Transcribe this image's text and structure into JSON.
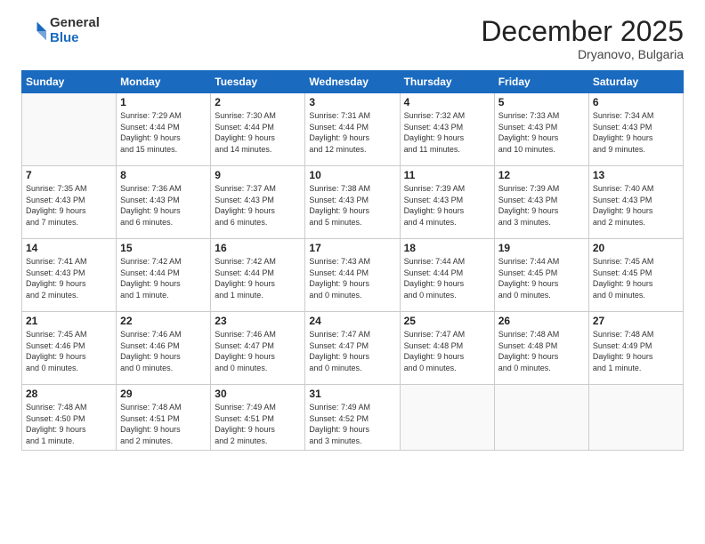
{
  "logo": {
    "general": "General",
    "blue": "Blue"
  },
  "header": {
    "month": "December 2025",
    "location": "Dryanovo, Bulgaria"
  },
  "weekdays": [
    "Sunday",
    "Monday",
    "Tuesday",
    "Wednesday",
    "Thursday",
    "Friday",
    "Saturday"
  ],
  "weeks": [
    [
      {
        "day": "",
        "info": ""
      },
      {
        "day": "1",
        "info": "Sunrise: 7:29 AM\nSunset: 4:44 PM\nDaylight: 9 hours\nand 15 minutes."
      },
      {
        "day": "2",
        "info": "Sunrise: 7:30 AM\nSunset: 4:44 PM\nDaylight: 9 hours\nand 14 minutes."
      },
      {
        "day": "3",
        "info": "Sunrise: 7:31 AM\nSunset: 4:44 PM\nDaylight: 9 hours\nand 12 minutes."
      },
      {
        "day": "4",
        "info": "Sunrise: 7:32 AM\nSunset: 4:43 PM\nDaylight: 9 hours\nand 11 minutes."
      },
      {
        "day": "5",
        "info": "Sunrise: 7:33 AM\nSunset: 4:43 PM\nDaylight: 9 hours\nand 10 minutes."
      },
      {
        "day": "6",
        "info": "Sunrise: 7:34 AM\nSunset: 4:43 PM\nDaylight: 9 hours\nand 9 minutes."
      }
    ],
    [
      {
        "day": "7",
        "info": "Sunrise: 7:35 AM\nSunset: 4:43 PM\nDaylight: 9 hours\nand 7 minutes."
      },
      {
        "day": "8",
        "info": "Sunrise: 7:36 AM\nSunset: 4:43 PM\nDaylight: 9 hours\nand 6 minutes."
      },
      {
        "day": "9",
        "info": "Sunrise: 7:37 AM\nSunset: 4:43 PM\nDaylight: 9 hours\nand 6 minutes."
      },
      {
        "day": "10",
        "info": "Sunrise: 7:38 AM\nSunset: 4:43 PM\nDaylight: 9 hours\nand 5 minutes."
      },
      {
        "day": "11",
        "info": "Sunrise: 7:39 AM\nSunset: 4:43 PM\nDaylight: 9 hours\nand 4 minutes."
      },
      {
        "day": "12",
        "info": "Sunrise: 7:39 AM\nSunset: 4:43 PM\nDaylight: 9 hours\nand 3 minutes."
      },
      {
        "day": "13",
        "info": "Sunrise: 7:40 AM\nSunset: 4:43 PM\nDaylight: 9 hours\nand 2 minutes."
      }
    ],
    [
      {
        "day": "14",
        "info": "Sunrise: 7:41 AM\nSunset: 4:43 PM\nDaylight: 9 hours\nand 2 minutes."
      },
      {
        "day": "15",
        "info": "Sunrise: 7:42 AM\nSunset: 4:44 PM\nDaylight: 9 hours\nand 1 minute."
      },
      {
        "day": "16",
        "info": "Sunrise: 7:42 AM\nSunset: 4:44 PM\nDaylight: 9 hours\nand 1 minute."
      },
      {
        "day": "17",
        "info": "Sunrise: 7:43 AM\nSunset: 4:44 PM\nDaylight: 9 hours\nand 0 minutes."
      },
      {
        "day": "18",
        "info": "Sunrise: 7:44 AM\nSunset: 4:44 PM\nDaylight: 9 hours\nand 0 minutes."
      },
      {
        "day": "19",
        "info": "Sunrise: 7:44 AM\nSunset: 4:45 PM\nDaylight: 9 hours\nand 0 minutes."
      },
      {
        "day": "20",
        "info": "Sunrise: 7:45 AM\nSunset: 4:45 PM\nDaylight: 9 hours\nand 0 minutes."
      }
    ],
    [
      {
        "day": "21",
        "info": "Sunrise: 7:45 AM\nSunset: 4:46 PM\nDaylight: 9 hours\nand 0 minutes."
      },
      {
        "day": "22",
        "info": "Sunrise: 7:46 AM\nSunset: 4:46 PM\nDaylight: 9 hours\nand 0 minutes."
      },
      {
        "day": "23",
        "info": "Sunrise: 7:46 AM\nSunset: 4:47 PM\nDaylight: 9 hours\nand 0 minutes."
      },
      {
        "day": "24",
        "info": "Sunrise: 7:47 AM\nSunset: 4:47 PM\nDaylight: 9 hours\nand 0 minutes."
      },
      {
        "day": "25",
        "info": "Sunrise: 7:47 AM\nSunset: 4:48 PM\nDaylight: 9 hours\nand 0 minutes."
      },
      {
        "day": "26",
        "info": "Sunrise: 7:48 AM\nSunset: 4:48 PM\nDaylight: 9 hours\nand 0 minutes."
      },
      {
        "day": "27",
        "info": "Sunrise: 7:48 AM\nSunset: 4:49 PM\nDaylight: 9 hours\nand 1 minute."
      }
    ],
    [
      {
        "day": "28",
        "info": "Sunrise: 7:48 AM\nSunset: 4:50 PM\nDaylight: 9 hours\nand 1 minute."
      },
      {
        "day": "29",
        "info": "Sunrise: 7:48 AM\nSunset: 4:51 PM\nDaylight: 9 hours\nand 2 minutes."
      },
      {
        "day": "30",
        "info": "Sunrise: 7:49 AM\nSunset: 4:51 PM\nDaylight: 9 hours\nand 2 minutes."
      },
      {
        "day": "31",
        "info": "Sunrise: 7:49 AM\nSunset: 4:52 PM\nDaylight: 9 hours\nand 3 minutes."
      },
      {
        "day": "",
        "info": ""
      },
      {
        "day": "",
        "info": ""
      },
      {
        "day": "",
        "info": ""
      }
    ]
  ]
}
